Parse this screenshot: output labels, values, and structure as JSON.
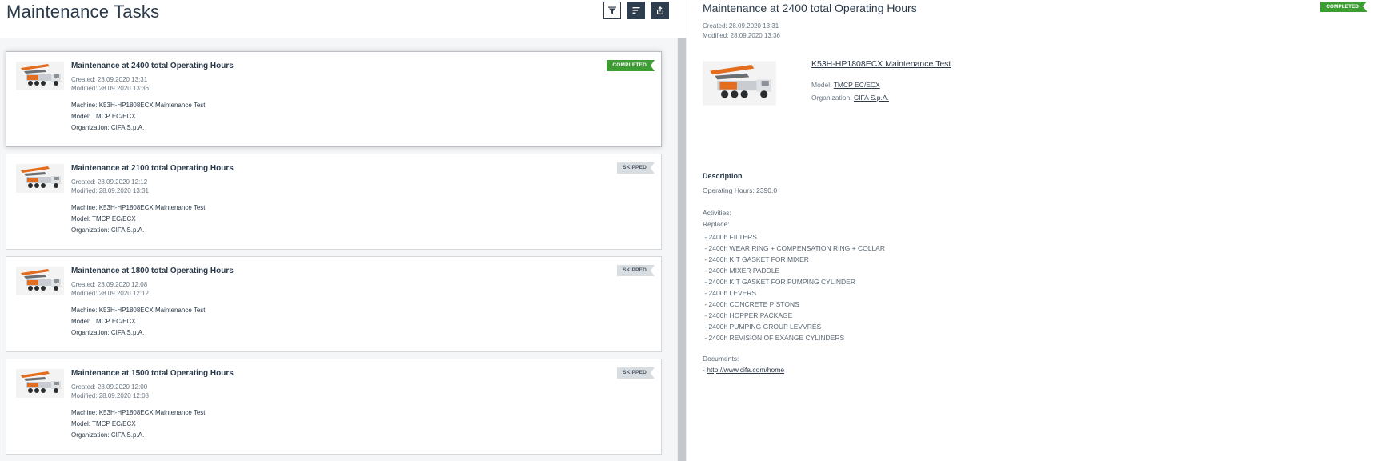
{
  "header": {
    "title": "Maintenance Tasks",
    "filter_icon": "filter-icon",
    "sort_icon": "sort-icon",
    "export_icon": "export-icon"
  },
  "labels": {
    "created": "Created:",
    "modified": "Modified:",
    "machine": "Machine:",
    "model": "Model:",
    "organization": "Organization:"
  },
  "tasks": [
    {
      "title": "Maintenance at 2400 total Operating Hours",
      "created": "28.09.2020 13:31",
      "modified": "28.09.2020 13:36",
      "machine": "K53H-HP1808ECX Maintenance Test",
      "model": "TMCP EC/ECX",
      "organization": "CIFA S.p.A.",
      "status": "COMPLETED"
    },
    {
      "title": "Maintenance at 2100 total Operating Hours",
      "created": "28.09.2020 12:12",
      "modified": "28.09.2020 13:31",
      "machine": "K53H-HP1808ECX Maintenance Test",
      "model": "TMCP EC/ECX",
      "organization": "CIFA S.p.A.",
      "status": "SKIPPED"
    },
    {
      "title": "Maintenance at 1800 total Operating Hours",
      "created": "28.09.2020 12:08",
      "modified": "28.09.2020 12:12",
      "machine": "K53H-HP1808ECX Maintenance Test",
      "model": "TMCP EC/ECX",
      "organization": "CIFA S.p.A.",
      "status": "SKIPPED"
    },
    {
      "title": "Maintenance at 1500 total Operating Hours",
      "created": "28.09.2020 12:00",
      "modified": "28.09.2020 12:08",
      "machine": "K53H-HP1808ECX Maintenance Test",
      "model": "TMCP EC/ECX",
      "organization": "CIFA S.p.A.",
      "status": "SKIPPED"
    }
  ],
  "detail": {
    "title": "Maintenance at 2400 total Operating Hours",
    "status": "COMPLETED",
    "created_line": "Created: 28.09.2020 13:31",
    "modified_line": "Modified: 28.09.2020 13:36",
    "machine_link": "K53H-HP1808ECX Maintenance Test",
    "model_label": "Model:",
    "model_value": "TMCP EC/ECX",
    "org_label": "Organization:",
    "org_value": "CIFA S.p.A.",
    "description_heading": "Description",
    "operating_hours": "Operating Hours: 2390.0",
    "activities_label": "Activities:",
    "replace_label": "Replace:",
    "activities": [
      " - 2400h FILTERS",
      " - 2400h WEAR RING + COMPENSATION RING + COLLAR",
      " - 2400h KIT GASKET FOR MIXER",
      " - 2400h MIXER PADDLE",
      " - 2400h KIT GASKET FOR PUMPING CYLINDER",
      " - 2400h LEVERS",
      " - 2400h CONCRETE PISTONS",
      " - 2400h HOPPER PACKAGE",
      " - 2400h PUMPING GROUP LEVVRES",
      " - 2400h REVISION OF EXANGE CYLINDERS"
    ],
    "documents_label": "Documents:",
    "document_prefix": "- ",
    "document_link": "http://www.cifa.com/home"
  },
  "colors": {
    "completed": "#3d9c34",
    "skipped": "#d8dde2",
    "text_dark": "#2b3a4a",
    "toolbar": "#2f3e4e"
  }
}
